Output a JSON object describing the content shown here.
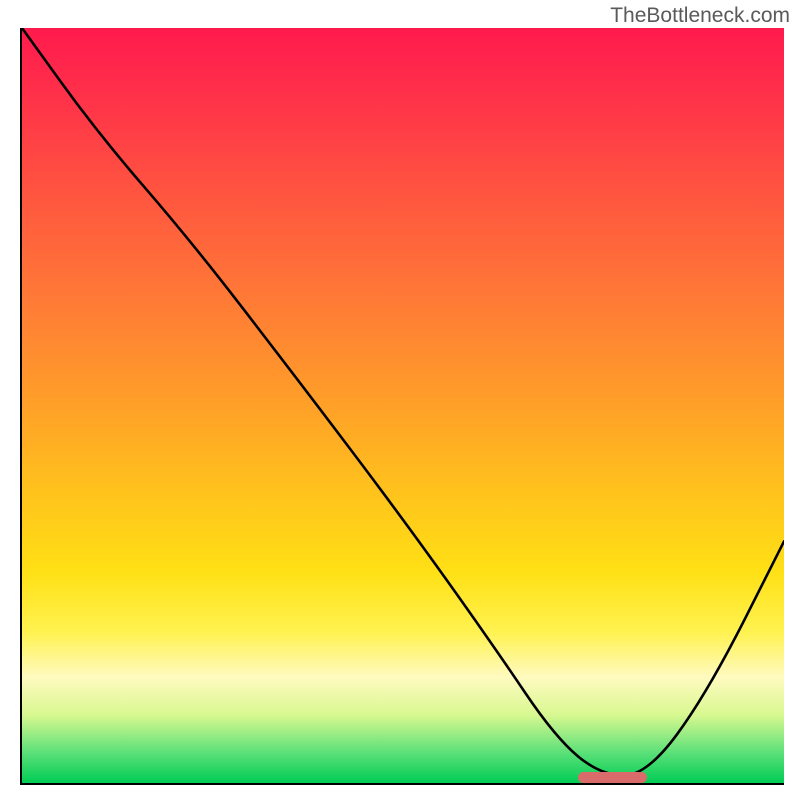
{
  "watermark": "TheBottleneck.com",
  "chart_data": {
    "type": "line",
    "title": "",
    "xlabel": "",
    "ylabel": "",
    "xlim": [
      0,
      100
    ],
    "ylim": [
      0,
      100
    ],
    "series": [
      {
        "name": "curve",
        "x": [
          0,
          10,
          22,
          35,
          50,
          62,
          70,
          76,
          82,
          90,
          100
        ],
        "y": [
          100,
          86,
          72,
          55,
          35,
          18,
          6,
          1,
          1,
          12,
          32
        ]
      }
    ],
    "marker": {
      "x_start": 73,
      "x_end": 82,
      "y": 0.7
    },
    "gradient_colors": {
      "top": "#ff1a4d",
      "mid_upper": "#ff7a36",
      "mid": "#ffc41c",
      "mid_lower": "#fff250",
      "bottom": "#00cc55"
    }
  }
}
